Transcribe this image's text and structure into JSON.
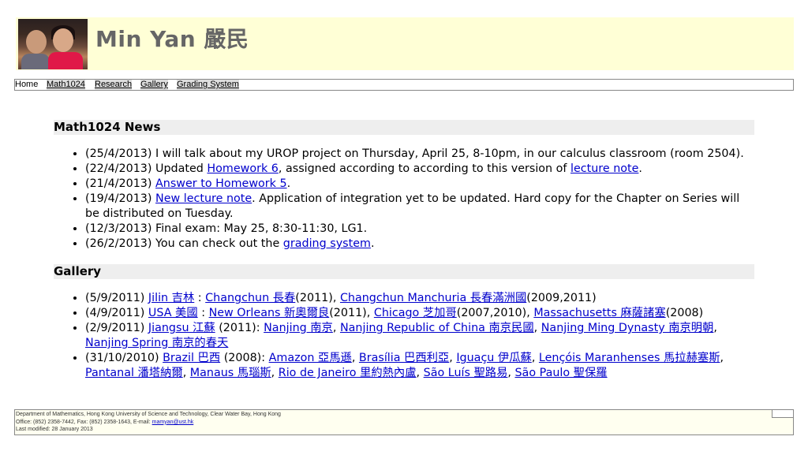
{
  "header": {
    "title": "Min Yan 嚴民",
    "photo_alt": "photo"
  },
  "nav": {
    "items": [
      {
        "label": "Home"
      },
      {
        "label": "Math1024"
      },
      {
        "label": "Research"
      },
      {
        "label": "Gallery"
      },
      {
        "label": "Grading System"
      }
    ]
  },
  "news": {
    "heading": "Math1024 News",
    "items": [
      {
        "date": "(25/4/2013)",
        "text": " I will talk about my UROP project on Thursday, April 25, 8-10pm, in our calculus classroom (room 2504)."
      },
      {
        "date": "(22/4/2013)",
        "pre": " Updated ",
        "link1": "Homework 6",
        "mid": ", assigned according to according to this version of ",
        "link2": "lecture note",
        "post": "."
      },
      {
        "date": "(21/4/2013)",
        "link": "Answer to Homework 5",
        "post": "."
      },
      {
        "date": "(19/4/2013)",
        "link": "New lecture note",
        "post": ". Application of integration yet to be updated. Hard copy for the Chapter on Series will be distributed on Tuesday."
      },
      {
        "date": "(12/3/2013)",
        "text": " Final exam: May 25, 8:30-11:30, LG1."
      },
      {
        "date": "(26/2/2013)",
        "pre": " You can check out the ",
        "link": "grading system",
        "post": "."
      }
    ]
  },
  "gallery": {
    "heading": "Gallery",
    "items": [
      {
        "date": "(5/9/2011)",
        "l1": "Jilin 吉林",
        "s1": " : ",
        "l2": "Changchun 長春",
        "s2": "(2011), ",
        "l3": "Changchun Manchuria 長春滿洲國",
        "s3": "(2009,2011)"
      },
      {
        "date": "(4/9/2011)",
        "l1": "USA 美國",
        "s1": " : ",
        "l2": "New Orleans 新奧爾良",
        "s2": "(2011), ",
        "l3": "Chicago 芝加哥",
        "s3": "(2007,2010), ",
        "l4": "Massachusetts 麻薩諸塞",
        "s4": "(2008)"
      },
      {
        "date": "(2/9/2011)",
        "l1": "Jiangsu 江蘇",
        "s1": " (2011): ",
        "l2": "Nanjing 南京",
        "s2": ", ",
        "l3": "Nanjing Republic of China 南京民國",
        "s3": ", ",
        "l4": "Nanjing Ming Dynasty 南京明朝",
        "s4": ", ",
        "l5": "Nanjing Spring 南京的春天"
      },
      {
        "date": "(31/10/2010)",
        "l1": "Brazil 巴西",
        "s1": " (2008): ",
        "l2": "Amazon 亞馬遜",
        "s2": ", ",
        "l3": "Brasília 巴西利亞",
        "s3": ", ",
        "l4": "Iguaçu 伊瓜蘇",
        "s4": ", ",
        "l5": "Lençóis Maranhenses 馬拉赫塞斯",
        "s5": ", ",
        "l6": "Pantanal 潘塔納爾",
        "s6": ", ",
        "l7": "Manaus 馬瑙斯",
        "s7": ", ",
        "l8": "Rio de Janeiro 里約熱內盧",
        "s8": ", ",
        "l9": "São Luís 聖路易",
        "s9": ", ",
        "l10": "São Paulo 聖保羅"
      }
    ]
  },
  "footer": {
    "line1": "Department of Mathematics, Hong Kong University of Science and Technology, Clear Water Bay, Hong Kong",
    "line2_pre": "Office: (852) 2358-7442, Fax: (852) 2358-1643, E-mail: ",
    "email": "mamyan@ust.hk",
    "line3": "Last modified: 28 January 2013"
  }
}
